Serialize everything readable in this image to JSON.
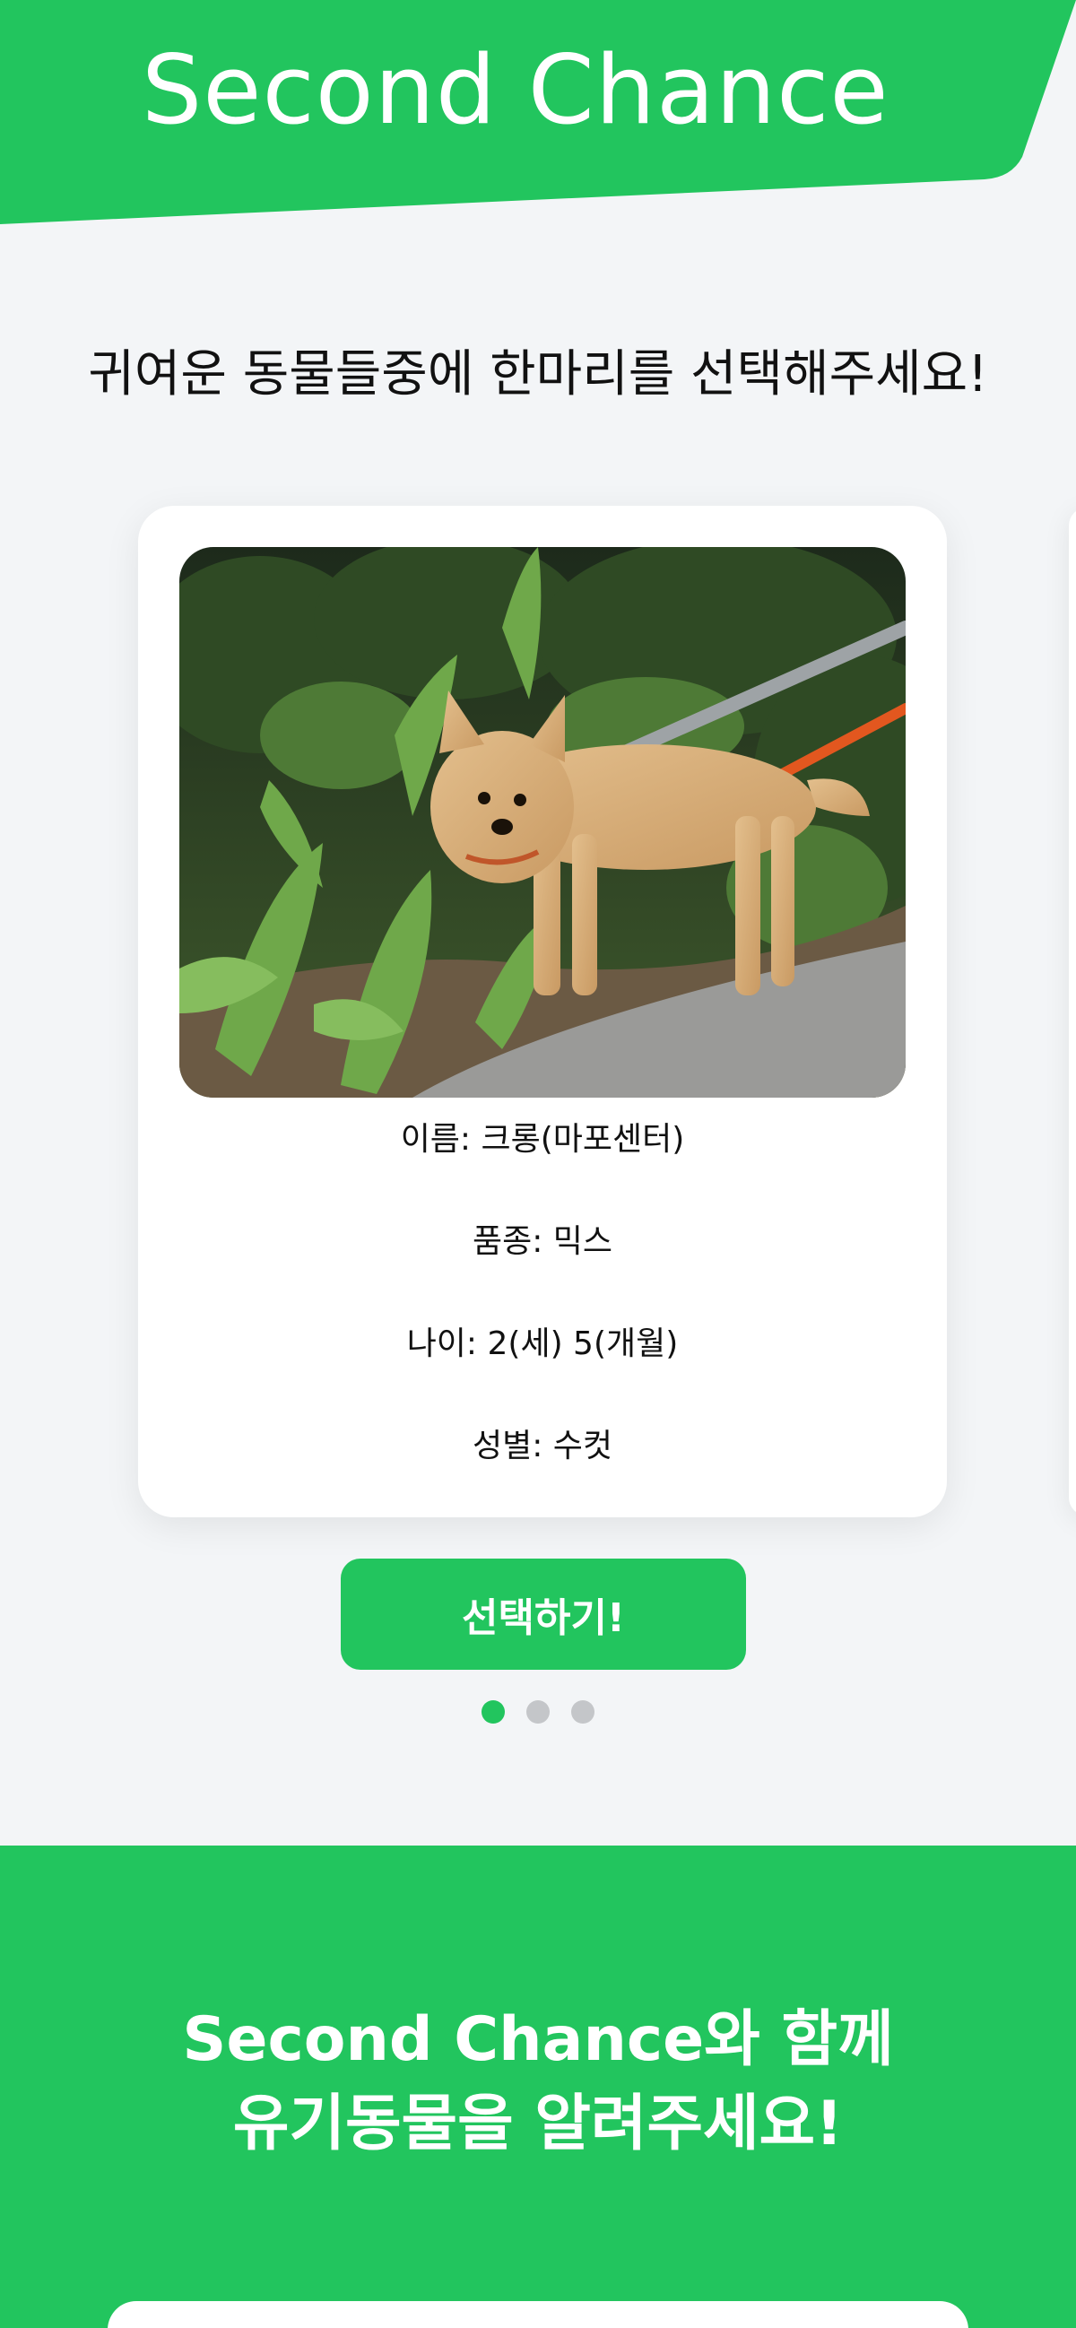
{
  "header": {
    "title": "Second Chance",
    "color": "#22c55e"
  },
  "instruction": "귀여운 동물들중에 한마리를 선택해주세요!",
  "animal_card": {
    "photo_icon": "dog-photo",
    "name_line": "이름: 크롱(마포센터)",
    "breed_line": "품종: 믹스",
    "age_line": "나이: 2(세) 5(개월)",
    "sex_line": "성별: 수컷"
  },
  "select_button_label": "선택하기!",
  "carousel": {
    "total": 3,
    "active_index": 0
  },
  "promo": {
    "line1": "Second Chance와 함께",
    "line2": "유기동물을 알려주세요!"
  },
  "colors": {
    "accent": "#22c55e",
    "background": "#f3f5f7",
    "dot_inactive": "#c4c6c9"
  }
}
